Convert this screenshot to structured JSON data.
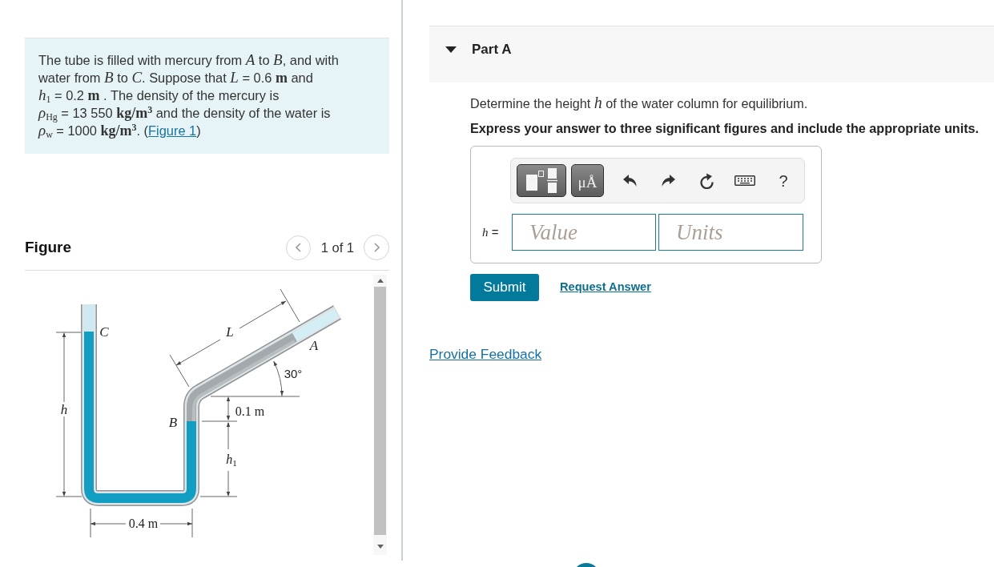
{
  "problem": {
    "text": "The tube is filled with mercury from *A* to *B*, and with water from *B* to *C*. Suppose that *L* = 0.6 **m** and *h*$_{1}$ = 0.2 **m** . The density of the mercury is *ρ*$_{Hg}$ = 13 550 **kg/m**$^{3}$ and the density of the water is *ρ*$_{w}$ = 1000 **kg/m**$^{3}$. (",
    "link": "Figure 1",
    "text_after": ")"
  },
  "figure": {
    "title": "Figure",
    "pager": "1 of 1",
    "labels": [
      {
        "text": "C",
        "kind": "variable"
      },
      {
        "text": "L",
        "kind": "variable"
      },
      {
        "text": "A",
        "kind": "variable"
      },
      {
        "text": "30°",
        "kind": "angle"
      },
      {
        "text": "h",
        "kind": "variable"
      },
      {
        "text": "0.1 m",
        "kind": "measure"
      },
      {
        "text": "B",
        "kind": "variable"
      },
      {
        "text": "*h*$_{1}$",
        "kind": "measure"
      },
      {
        "text": "0.4 m",
        "kind": "measure"
      }
    ]
  },
  "part": {
    "title": "Part A",
    "expanded": true,
    "question": "Determine the height *h* of the water column for equilibrium.",
    "instruction": "Express your answer to three significant figures and include the appropriate units.",
    "toolbar": {
      "units_button": "μÅ",
      "help_button": "?"
    },
    "answer_label": "*h* =",
    "value_field": {
      "placeholder": "Value"
    },
    "units_field": {
      "placeholder": "Units"
    },
    "submit": "Submit",
    "request_answer": "Request Answer"
  },
  "feedback_link": "Provide Feedback"
}
